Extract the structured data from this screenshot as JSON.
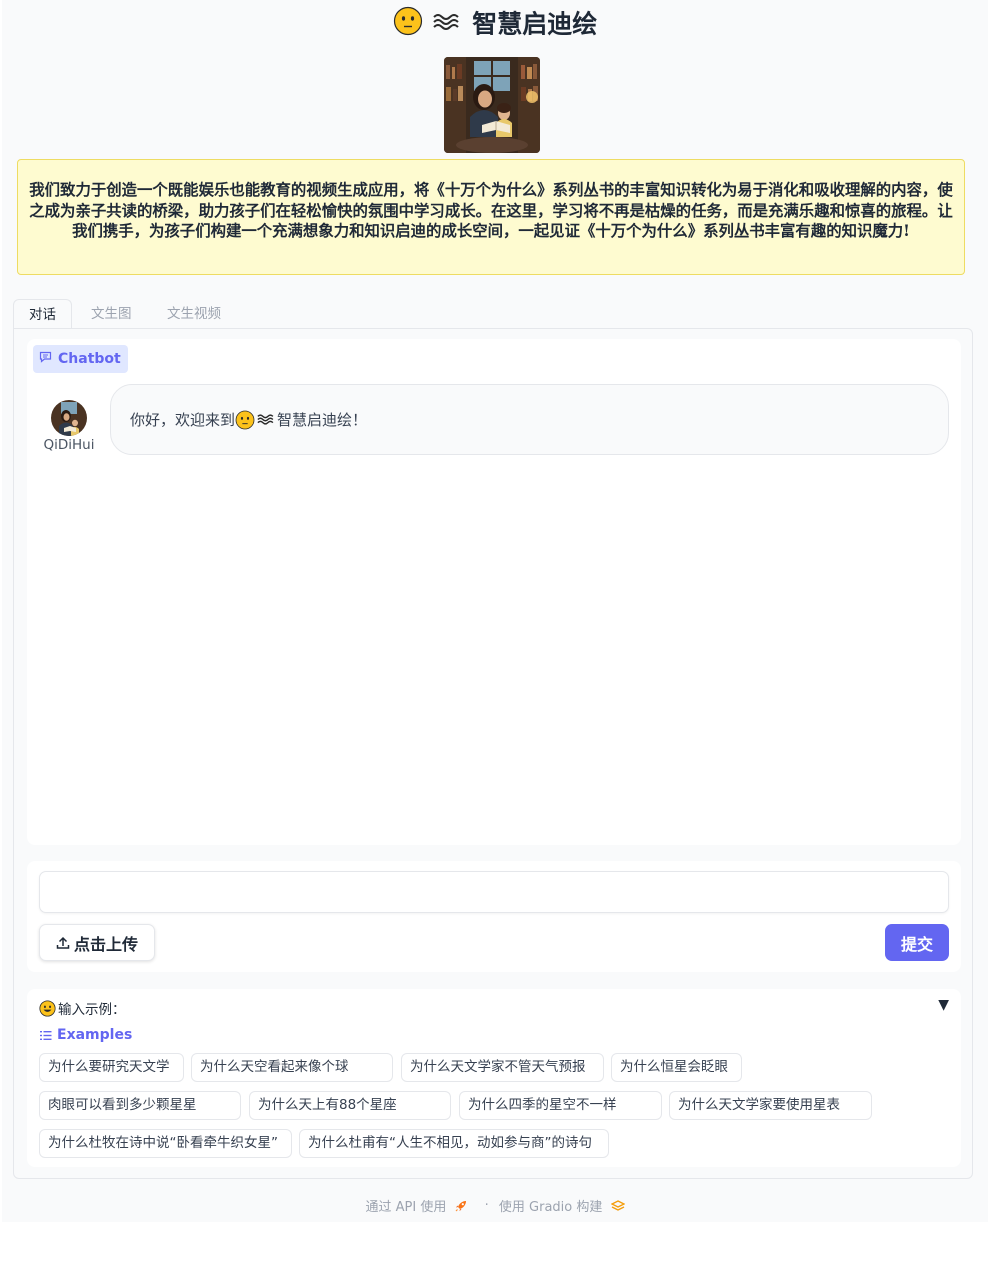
{
  "app": {
    "title": "智慧启迪绘",
    "intro": "我们致力于创造一个既能娱乐也能教育的视频生成应用，将《十万个为什么》系列丛书的丰富知识转化为易于消化和吸收理解的内容，使之成为亲子共读的桥梁，助力孩子们在轻松愉快的氛围中学习成长。在这里，学习将不再是枯燥的任务，而是充满乐趣和惊喜的旅程。让我们携手，为孩子们构建一个充满想象力和知识启迪的成长空间，一起见证《十万个为什么》系列丛书丰富有趣的知识魔力!"
  },
  "tabs": [
    {
      "label": "对话",
      "active": true
    },
    {
      "label": "文生图",
      "active": false
    },
    {
      "label": "文生视频",
      "active": false
    }
  ],
  "chatbot": {
    "label": "Chatbot",
    "bot_name": "QiDiHui",
    "greeting_prefix": "你好，欢迎来到",
    "greeting_suffix": "智慧启迪绘！"
  },
  "input": {
    "value": "",
    "upload_label": "点击上传",
    "submit_label": "提交"
  },
  "examples": {
    "header": "输入示例：",
    "label": "Examples",
    "items": [
      "为什么要研究天文学",
      "为什么天空看起来像个球",
      "为什么天文学家不管天气预报",
      "为什么恒星会眨眼",
      "肉眼可以看到多少颗星星",
      "为什么天上有88个星座",
      "为什么四季的星空不一样",
      "为什么天文学家要使用星表",
      "为什么杜牧在诗中说“卧看牵牛织女星”",
      "为什么杜甫有“人生不相见，动如参与商”的诗句"
    ]
  },
  "footer": {
    "api": "通过 API 使用",
    "separator": "·",
    "built": "使用 Gradio 构建"
  },
  "colors": {
    "accent": "#6366f1",
    "intro_bg": "#fefbd0",
    "intro_border": "#eedc62"
  }
}
